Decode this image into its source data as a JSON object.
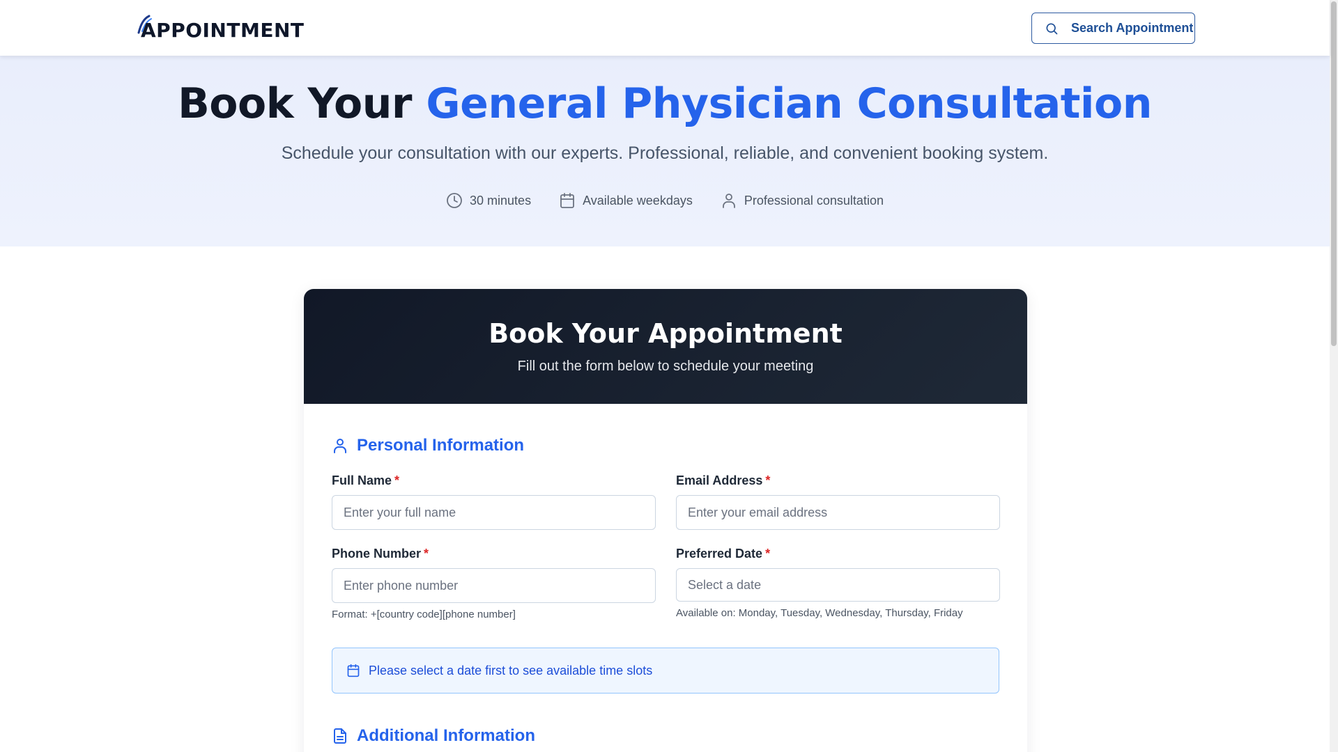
{
  "header": {
    "logo_text": "APPOINTMENT",
    "search_button_label": "Search Appointment"
  },
  "hero": {
    "title_prefix": "Book Your ",
    "title_accent": "General Physician Consultation",
    "subtitle": "Schedule your consultation with our experts. Professional, reliable, and convenient booking system.",
    "features": [
      {
        "icon": "clock-icon",
        "label": "30 minutes"
      },
      {
        "icon": "calendar-icon",
        "label": "Available weekdays"
      },
      {
        "icon": "user-icon",
        "label": "Professional consultation"
      }
    ]
  },
  "form": {
    "title": "Book Your Appointment",
    "subtitle": "Fill out the form below to schedule your meeting",
    "personal_section": {
      "title": "Personal Information",
      "full_name": {
        "label": "Full Name",
        "required_mark": "*",
        "placeholder": "Enter your full name",
        "value": ""
      },
      "email": {
        "label": "Email Address",
        "required_mark": "*",
        "placeholder": "Enter your email address",
        "value": ""
      },
      "phone": {
        "label": "Phone Number",
        "required_mark": "*",
        "placeholder": "Enter phone number",
        "value": "",
        "hint": "Format: +[country code][phone number]"
      },
      "date": {
        "label": "Preferred Date",
        "required_mark": "*",
        "placeholder": "Select a date",
        "value": "",
        "hint": "Available on: Monday, Tuesday, Wednesday, Thursday, Friday"
      }
    },
    "time_slot_notice": "Please select a date first to see available time slots",
    "additional_section": {
      "title": "Additional Information"
    }
  },
  "colors": {
    "accent": "#2563eb",
    "dark_header": "#111827",
    "hero_bg": "#e9eefc",
    "required": "#dc2626"
  }
}
